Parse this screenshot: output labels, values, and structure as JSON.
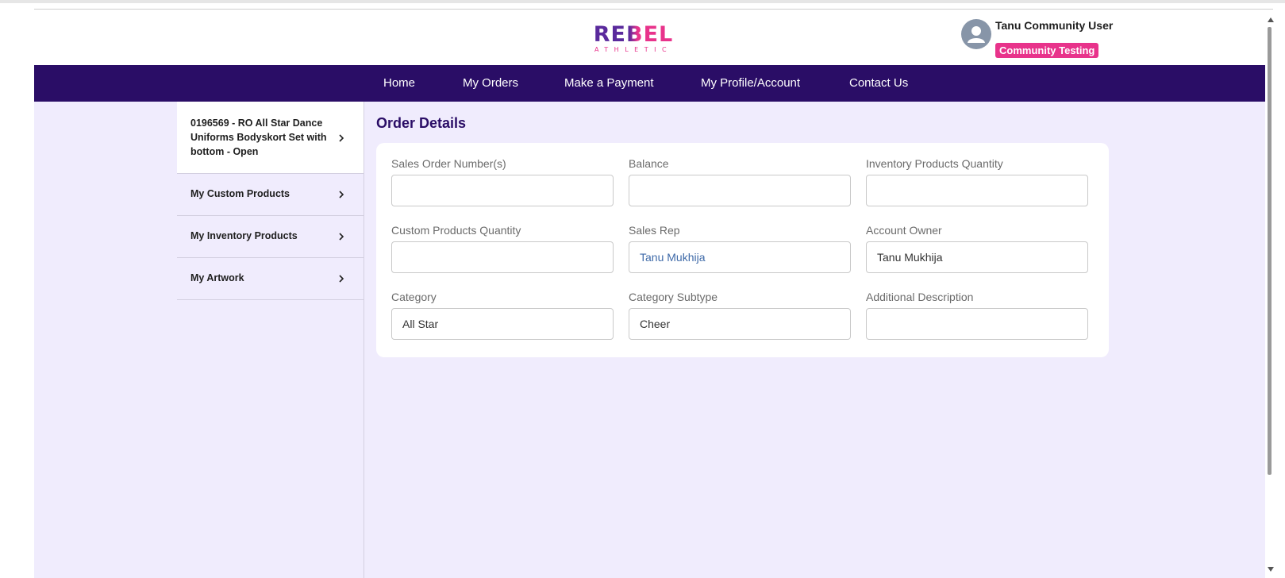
{
  "header": {
    "logo_text": "REBEL",
    "logo_sub": "ATHLETIC",
    "user_name": "Tanu Community User",
    "user_badge": "Community Testing"
  },
  "nav": {
    "items": [
      "Home",
      "My Orders",
      "Make a Payment",
      "My Profile/Account",
      "Contact Us"
    ]
  },
  "sidebar": {
    "items": [
      {
        "lines": [
          "0196569 - RO All Star Dance",
          "Uniforms Bodyskort Set with",
          "bottom - Open"
        ]
      },
      {
        "lines": [
          "My Custom Products"
        ]
      },
      {
        "lines": [
          "My Inventory Products"
        ]
      },
      {
        "lines": [
          "My Artwork"
        ]
      }
    ]
  },
  "main": {
    "title": "Order Details",
    "fields": [
      {
        "label": "Sales Order Number(s)",
        "value": ""
      },
      {
        "label": "Balance",
        "value": ""
      },
      {
        "label": "Inventory Products Quantity",
        "value": ""
      },
      {
        "label": "Custom Products Quantity",
        "value": ""
      },
      {
        "label": "Sales Rep",
        "value": "Tanu Mukhija"
      },
      {
        "label": "Account Owner",
        "value": "Tanu Mukhija"
      },
      {
        "label": "Category",
        "value": "All Star"
      },
      {
        "label": "Category Subtype",
        "value": "Cheer"
      },
      {
        "label": "Additional Description",
        "value": ""
      }
    ]
  },
  "colors": {
    "nav_bg": "#2a0d66",
    "content_bg": "#f0ecfd",
    "badge": "#e8338b",
    "logo_pink": "#e8338b",
    "logo_purple": "#5a2a9c"
  }
}
